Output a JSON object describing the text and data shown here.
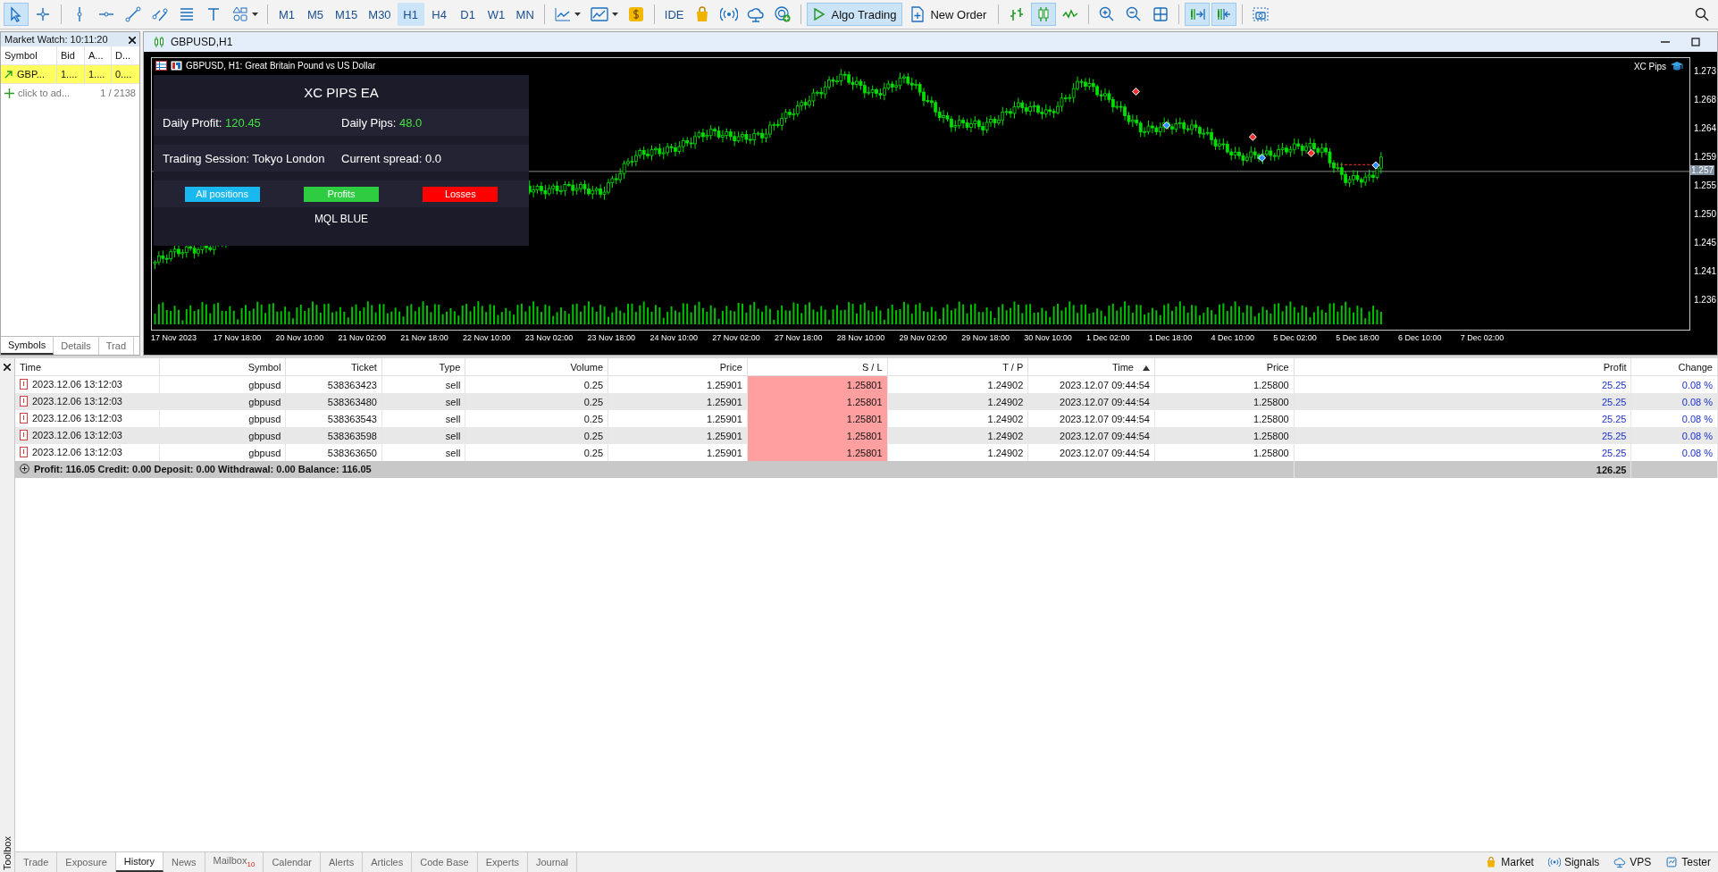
{
  "toolbar": {
    "tools": [
      {
        "kind": "cursor",
        "selected": true
      },
      {
        "kind": "crosshair",
        "selected": false
      },
      {
        "kind": "vertical-line",
        "selected": false
      },
      {
        "kind": "horizontal-line",
        "selected": false
      },
      {
        "kind": "trend-line",
        "selected": false
      },
      {
        "kind": "channel",
        "selected": false
      },
      {
        "kind": "fibonacci",
        "selected": false
      },
      {
        "kind": "text-tool",
        "selected": false
      },
      {
        "kind": "shapes",
        "selected": false
      }
    ],
    "timeframes": [
      {
        "label": "M1",
        "selected": false
      },
      {
        "label": "M5",
        "selected": false
      },
      {
        "label": "M15",
        "selected": false
      },
      {
        "label": "M30",
        "selected": false
      },
      {
        "label": "H1",
        "selected": true
      },
      {
        "label": "H4",
        "selected": false
      },
      {
        "label": "D1",
        "selected": false
      },
      {
        "label": "W1",
        "selected": false
      },
      {
        "label": "MN",
        "selected": false
      }
    ],
    "ide": "IDE",
    "algo_trading": {
      "label": "Algo Trading",
      "on": true
    },
    "new_order": "New Order",
    "chart_tools": [
      {
        "kind": "bars",
        "selected": false
      },
      {
        "kind": "candles",
        "selected": true
      },
      {
        "kind": "line",
        "selected": false
      },
      {
        "kind": "zoom-in",
        "selected": false
      },
      {
        "kind": "zoom-out",
        "selected": false
      },
      {
        "kind": "grid",
        "selected": false
      },
      {
        "kind": "autoscroll",
        "selected": true
      },
      {
        "kind": "chart-shift",
        "selected": true
      },
      {
        "kind": "screenshot",
        "selected": false
      }
    ]
  },
  "market_watch": {
    "title": "Market Watch: 10:11:20",
    "columns": [
      "Symbol",
      "Bid",
      "A...",
      "D..."
    ],
    "rows": [
      {
        "symbol": "GBP...",
        "bid": "1....",
        "ask": "1....",
        "daily": "0....",
        "selected": true
      }
    ],
    "add_label": "click to ad...",
    "count": "1 / 2138",
    "tabs": [
      {
        "label": "Symbols",
        "selected": true
      },
      {
        "label": "Details",
        "selected": false
      },
      {
        "label": "Trad",
        "selected": false
      }
    ]
  },
  "chart": {
    "title": "GBPUSD,H1",
    "header": "GBPUSD, H1:  Great Britain Pound vs US Dollar",
    "indicator": "XC Pips",
    "price_axis": [
      "1.273",
      "1.268",
      "1.264",
      "1.259",
      "1.255",
      "1.250",
      "1.245",
      "1.241",
      "1.236"
    ],
    "current_price": "1.257",
    "time_axis": [
      "17 Nov 2023",
      "17 Nov 18:00",
      "20 Nov 10:00",
      "21 Nov 02:00",
      "21 Nov 18:00",
      "22 Nov 10:00",
      "23 Nov 02:00",
      "23 Nov 18:00",
      "24 Nov 10:00",
      "27 Nov 02:00",
      "27 Nov 18:00",
      "28 Nov 10:00",
      "29 Nov 02:00",
      "29 Nov 18:00",
      "30 Nov 10:00",
      "1 Dec 02:00",
      "1 Dec 18:00",
      "4 Dec 10:00",
      "5 Dec 02:00",
      "5 Dec 18:00",
      "6 Dec 10:00",
      "7 Dec 02:00"
    ],
    "panel": {
      "title": "XC PIPS EA",
      "stats": [
        {
          "label": "Daily Profit:",
          "value": "120.45"
        },
        {
          "label": "Daily Pips:",
          "value": "48.0"
        }
      ],
      "info": [
        "Trading Session: Tokyo London",
        "Current spread: 0.0"
      ],
      "buttons": [
        {
          "label": "All positions",
          "color": "#1ab8f0"
        },
        {
          "label": "Profits",
          "color": "#2ecc40"
        },
        {
          "label": "Losses",
          "color": "#ff0000"
        }
      ],
      "footer": "MQL BLUE"
    }
  },
  "history": {
    "columns": [
      {
        "label": "Time",
        "sorted": false
      },
      {
        "label": "Symbol",
        "sorted": false
      },
      {
        "label": "Ticket",
        "sorted": false
      },
      {
        "label": "Type",
        "sorted": false
      },
      {
        "label": "Volume",
        "sorted": false
      },
      {
        "label": "Price",
        "sorted": false
      },
      {
        "label": "S / L",
        "sorted": false
      },
      {
        "label": "T / P",
        "sorted": false
      },
      {
        "label": "Time",
        "sorted": true
      },
      {
        "label": "Price",
        "sorted": false
      },
      {
        "label": "Profit",
        "sorted": false
      },
      {
        "label": "Change",
        "sorted": false
      }
    ],
    "rows": [
      {
        "cells": [
          "2023.12.06 13:12:03",
          "gbpusd",
          "538363423",
          "sell",
          "0.25",
          "1.25901",
          "1.25801",
          "1.24902",
          "2023.12.07 09:44:54",
          "1.25800",
          "25.25",
          "0.08 %"
        ],
        "sl_hit": true
      },
      {
        "cells": [
          "2023.12.06 13:12:03",
          "gbpusd",
          "538363480",
          "sell",
          "0.25",
          "1.25901",
          "1.25801",
          "1.24902",
          "2023.12.07 09:44:54",
          "1.25800",
          "25.25",
          "0.08 %"
        ],
        "sl_hit": true
      },
      {
        "cells": [
          "2023.12.06 13:12:03",
          "gbpusd",
          "538363543",
          "sell",
          "0.25",
          "1.25901",
          "1.25801",
          "1.24902",
          "2023.12.07 09:44:54",
          "1.25800",
          "25.25",
          "0.08 %"
        ],
        "sl_hit": true
      },
      {
        "cells": [
          "2023.12.06 13:12:03",
          "gbpusd",
          "538363598",
          "sell",
          "0.25",
          "1.25901",
          "1.25801",
          "1.24902",
          "2023.12.07 09:44:54",
          "1.25800",
          "25.25",
          "0.08 %"
        ],
        "sl_hit": true
      },
      {
        "cells": [
          "2023.12.06 13:12:03",
          "gbpusd",
          "538363650",
          "sell",
          "0.25",
          "1.25901",
          "1.25801",
          "1.24902",
          "2023.12.07 09:44:54",
          "1.25800",
          "25.25",
          "0.08 %"
        ],
        "sl_hit": true
      }
    ],
    "summary": "Profit: 116.05  Credit: 0.00  Deposit: 0.00  Withdrawal: 0.00  Balance: 116.05",
    "total": "126.25"
  },
  "toolbox": {
    "label": "Toolbox",
    "tabs": [
      {
        "label": "Trade",
        "selected": false
      },
      {
        "label": "Exposure",
        "selected": false
      },
      {
        "label": "History",
        "selected": true
      },
      {
        "label": "News",
        "selected": false
      },
      {
        "label": "Mailbox",
        "badge": "10",
        "selected": false
      },
      {
        "label": "Calendar",
        "selected": false
      },
      {
        "label": "Alerts",
        "selected": false
      },
      {
        "label": "Articles",
        "selected": false
      },
      {
        "label": "Code Base",
        "selected": false
      },
      {
        "label": "Experts",
        "selected": false
      },
      {
        "label": "Journal",
        "selected": false
      }
    ],
    "services": [
      {
        "kind": "market",
        "label": "Market"
      },
      {
        "kind": "signals",
        "label": "Signals"
      },
      {
        "kind": "vps",
        "label": "VPS"
      },
      {
        "kind": "tester",
        "label": "Tester"
      }
    ]
  }
}
